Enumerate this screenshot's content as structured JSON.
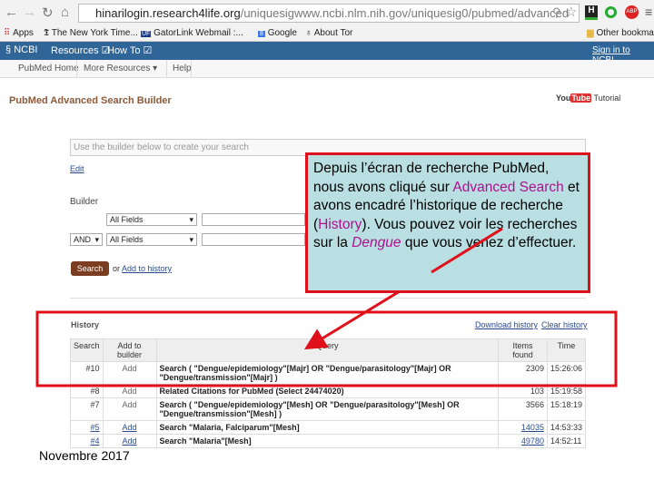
{
  "browser": {
    "url_host": "hinarilogin.research4life.org",
    "url_path": "/uniquesigwww.ncbi.nlm.nih.gov/uniquesig0/pubmed/advanced",
    "bookmarks": [
      "Apps",
      "The New York Time...",
      "GatorLink Webmail :...",
      "Google",
      "About Tor"
    ],
    "other_bookmarks": "Other bookmarks"
  },
  "ncbi": {
    "logo": "NCBI",
    "resources": "Resources",
    "howto": "How To",
    "signin": "Sign in to NCBI"
  },
  "subnav": [
    "PubMed Home",
    "More Resources",
    "Help"
  ],
  "page": {
    "title": "PubMed Advanced Search Builder",
    "youtube": "YouTube",
    "tutorial": "Tutorial",
    "search_placeholder": "Use the builder below to create your search",
    "edit": "Edit",
    "builder": "Builder",
    "field1": "All Fields",
    "field2": "All Fields",
    "operator": "AND",
    "search_btn": "Search",
    "or": "or",
    "add_history": "Add to history"
  },
  "history": {
    "title": "History",
    "download": "Download history",
    "clear": "Clear history",
    "headers": [
      "Search",
      "Add to builder",
      "Query",
      "Items found",
      "Time"
    ],
    "rows": [
      {
        "id": "#10",
        "add": "Add",
        "query": "Search ( \"Dengue/epidemiology\"[Majr] OR \"Dengue/parasitology\"[Majr] OR \"Dengue/transmission\"[Majr] )",
        "items": "2309",
        "time": "15:26:06"
      },
      {
        "id": "#8",
        "add": "Add",
        "query": "Related Citations for PubMed (Select 24474020)",
        "items": "103",
        "time": "15:19:58"
      },
      {
        "id": "#7",
        "add": "Add",
        "query": "Search ( \"Dengue/epidemiology\"[Mesh] OR \"Dengue/parasitology\"[Mesh] OR \"Dengue/transmission\"[Mesh] )",
        "items": "3566",
        "time": "15:18:19"
      },
      {
        "id": "#5",
        "add": "Add",
        "query": "Search \"Malaria, Falciparum\"[Mesh]",
        "items": "14035",
        "time": "14:53:33"
      },
      {
        "id": "#4",
        "add": "Add",
        "query": "Search \"Malaria\"[Mesh]",
        "items": "49780",
        "time": "14:52:11"
      }
    ]
  },
  "callout": {
    "t1": "Depuis l’écran de recherche PubMed, nous avons cliqué sur ",
    "h1": "Advanced Search",
    "t2": " et avons encadré l’historique de recherche (",
    "h2": "History",
    "t3": "). Vous pouvez voir les recherches sur la ",
    "h3": "Dengue",
    "t4": " que vous venez d’effectuer."
  },
  "footer": "Novembre 2017",
  "colors": {
    "annotation_red": "#e0101a",
    "callout_bg": "#b9dfe3",
    "highlight": "#b0108c",
    "ncbi_blue": "#2f6597"
  }
}
